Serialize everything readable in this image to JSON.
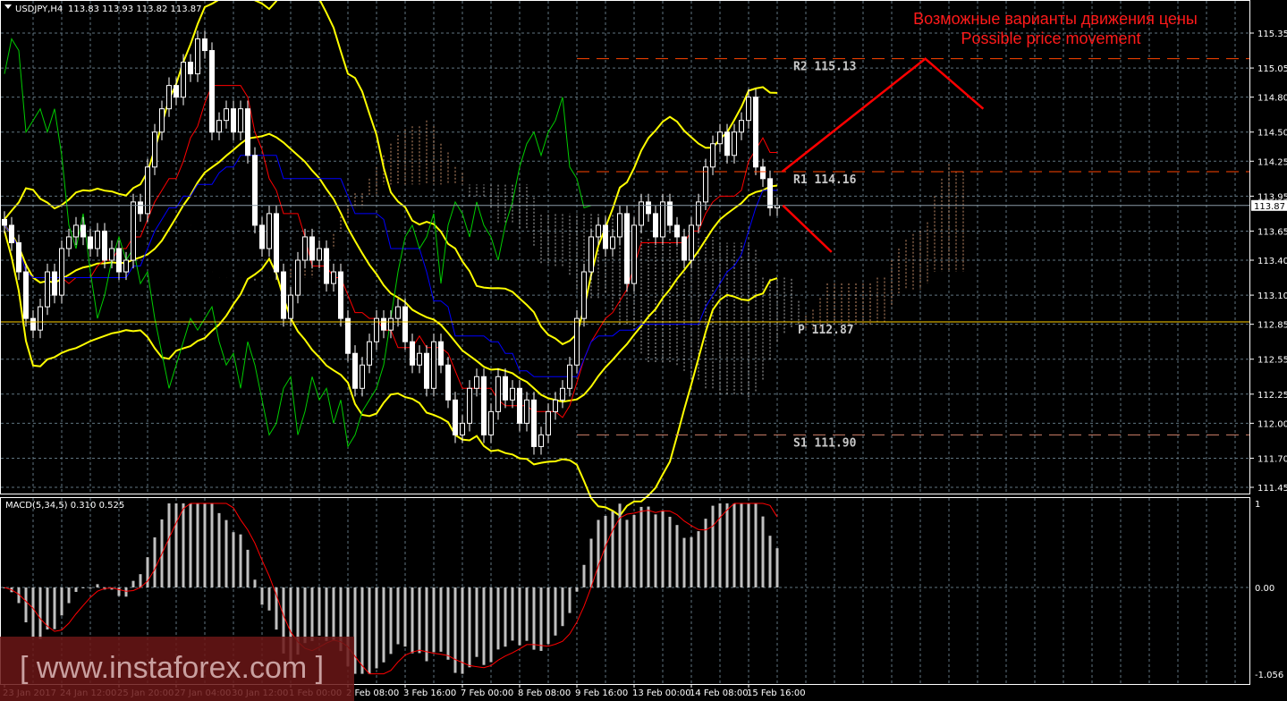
{
  "header": {
    "symbol": "USDJPY,H4",
    "ohlc": "113.83 113.93 113.82 113.87"
  },
  "forecast_title": {
    "line1": "Возможные варианты движения цены",
    "line2": "Possible price movement"
  },
  "watermark": "[ www.instaforex.com ]",
  "colors": {
    "background": "#000000",
    "grid": "#5f7480",
    "bollinger": "#ffff00",
    "tenkan": "#ff0000",
    "kijun": "#0000ff",
    "chikou": "#00cc00",
    "cloud": "#f4b183",
    "pivot": "#ffd000",
    "resistance": "#ff4500",
    "forecast": "#ff0000",
    "macd_hist": "#c0c0c0",
    "macd_signal": "#ff0000"
  },
  "chart_data": [
    {
      "type": "candlestick",
      "title": "USDJPY,H4",
      "ylim": [
        111.4,
        115.45
      ],
      "y_ticks": [
        "115.35",
        "115.05",
        "114.80",
        "114.50",
        "114.25",
        "113.95",
        "113.65",
        "113.40",
        "113.10",
        "112.85",
        "112.55",
        "112.25",
        "112.00",
        "111.70",
        "111.45"
      ],
      "x_ticks": [
        "23 Jan 2017",
        "24 Jan 12:00",
        "25 Jan 20:00",
        "27 Jan 04:00",
        "30 Jan 12:00",
        "1 Feb 00:00",
        "2 Feb 08:00",
        "3 Feb 16:00",
        "7 Feb 00:00",
        "8 Feb 08:00",
        "9 Feb 16:00",
        "13 Feb 00:00",
        "14 Feb 08:00",
        "15 Feb 16:00"
      ],
      "current_price": "113.87",
      "closes": [
        113.7,
        113.55,
        113.3,
        112.9,
        112.8,
        113.0,
        113.3,
        113.1,
        113.5,
        113.6,
        113.7,
        113.6,
        113.5,
        113.65,
        113.4,
        113.5,
        113.3,
        113.4,
        113.9,
        113.8,
        114.2,
        114.5,
        114.7,
        114.9,
        114.8,
        115.1,
        115.0,
        115.3,
        115.2,
        114.5,
        114.6,
        114.7,
        114.5,
        114.7,
        114.3,
        113.7,
        113.5,
        113.8,
        113.3,
        112.9,
        113.1,
        113.4,
        113.6,
        113.4,
        113.5,
        113.2,
        113.3,
        112.9,
        112.6,
        112.3,
        112.5,
        112.7,
        112.9,
        112.8,
        112.9,
        113.0,
        112.7,
        112.5,
        112.6,
        112.3,
        112.7,
        112.5,
        112.2,
        111.9,
        112.0,
        112.3,
        112.4,
        111.9,
        112.1,
        112.4,
        112.2,
        112.3,
        112.0,
        112.2,
        111.8,
        111.9,
        112.1,
        112.2,
        112.3,
        112.5,
        112.9,
        113.3,
        113.6,
        113.7,
        113.5,
        113.6,
        113.8,
        113.2,
        113.7,
        113.9,
        113.8,
        113.6,
        113.9,
        113.7,
        113.6,
        113.4,
        113.7,
        113.9,
        114.2,
        114.4,
        114.5,
        114.3,
        114.5,
        114.6,
        114.8,
        114.2,
        114.1,
        113.85,
        113.87
      ],
      "pivot_levels": [
        {
          "label": "R2",
          "value": 115.13,
          "text": "R2 115.13"
        },
        {
          "label": "R1",
          "value": 114.16,
          "text": "R1 114.16"
        },
        {
          "label": "P",
          "value": 112.87,
          "text": "P 112.87"
        },
        {
          "label": "S1",
          "value": 111.9,
          "text": "S1 111.90"
        }
      ],
      "forecast_paths": [
        {
          "direction": "up",
          "points": [
            {
              "bar": 108.7,
              "price": 114.16
            },
            {
              "bar": 128.7,
              "price": 115.13
            },
            {
              "bar": 136.8,
              "price": 114.7
            }
          ]
        },
        {
          "direction": "down",
          "points": [
            {
              "bar": 108.8,
              "price": 113.87
            },
            {
              "bar": 115.6,
              "price": 113.47
            }
          ]
        }
      ],
      "indicators": [
        "Bollinger Bands",
        "Ichimoku Kinko Hyo",
        "Pivot Points"
      ]
    },
    {
      "type": "bar",
      "title": "MACD(5,34,5) 0.310 0.525",
      "ylim": [
        -1.056,
        1
      ],
      "y_ticks": [
        "1",
        "0.00",
        "-1.056"
      ]
    }
  ]
}
